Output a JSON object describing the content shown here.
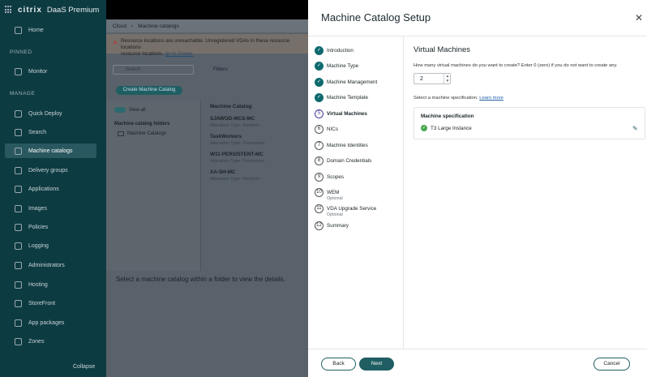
{
  "background": {
    "brand": {
      "logo": "citrix",
      "product": "DaaS Premium"
    },
    "nav": {
      "home": "Home",
      "pinned_section": "PINNED",
      "monitor": "Monitor",
      "manage_section": "MANAGE",
      "quick_deploy": "Quick Deploy",
      "search": "Search",
      "machine_catalogs": "Machine catalogs",
      "delivery_groups": "Delivery groups",
      "applications": "Applications",
      "images": "Images",
      "policies": "Policies",
      "logging": "Logging",
      "administrators": "Administrators",
      "hosting": "Hosting",
      "storefront": "StoreFront",
      "app_packages": "App packages",
      "zones": "Zones",
      "collapse": "Collapse"
    },
    "breadcrumb": {
      "root": "Cloud",
      "current": "Machine catalogs"
    },
    "warning": {
      "text": "Resource locations are unreachable. Unregistered VDAs in these resource locations",
      "link_prefix": "resource locations.",
      "link": "go to Zones."
    },
    "search_placeholder": "Search",
    "filters": "Filters",
    "create_button": "Create Machine Catalog",
    "view_all": "View all",
    "folders_title": "Machine catalog folders",
    "folder_name": "Machine Catalogs",
    "column_header": "Machine Catalog",
    "catalogs": [
      {
        "name": "SJAWOD-MCS-MC",
        "sub": "Allocation Type: Random"
      },
      {
        "name": "TaskWorkers",
        "sub": "Allocation Type: Permanent"
      },
      {
        "name": "W11-PERSISTENT-MC",
        "sub": "Allocation Type: Permanent"
      },
      {
        "name": "XA-SH-MC",
        "sub": "Allocation Type: Random"
      }
    ],
    "select_message": "Select a machine catalog within a folder to view the details."
  },
  "modal": {
    "title": "Machine Catalog Setup",
    "steps": [
      {
        "num": "1",
        "label": "Introduction",
        "state": "done"
      },
      {
        "num": "2",
        "label": "Machine Type",
        "state": "done"
      },
      {
        "num": "3",
        "label": "Machine Management",
        "state": "done"
      },
      {
        "num": "4",
        "label": "Machine Template",
        "state": "done"
      },
      {
        "num": "5",
        "label": "Virtual Machines",
        "state": "current"
      },
      {
        "num": "6",
        "label": "NICs",
        "state": "todo"
      },
      {
        "num": "7",
        "label": "Machine Identities",
        "state": "todo"
      },
      {
        "num": "8",
        "label": "Domain Credentials",
        "state": "todo"
      },
      {
        "num": "9",
        "label": "Scopes",
        "state": "todo"
      },
      {
        "num": "10",
        "label": "WEM",
        "sub": "Optional",
        "state": "todo"
      },
      {
        "num": "11",
        "label": "VDA Upgrade Service",
        "sub": "Optional",
        "state": "todo"
      },
      {
        "num": "12",
        "label": "Summary",
        "state": "todo"
      }
    ],
    "section_title": "Virtual Machines",
    "question": "How many virtual machines do you want to create? Enter 0 (zero) if you do not want to create any.",
    "vm_count": "2",
    "spec_prompt": "Select a machine specification.",
    "learn_more": "Learn more",
    "spec_header": "Machine specification",
    "spec_value": "T3 Large Instance",
    "buttons": {
      "back": "Back",
      "next": "Next",
      "cancel": "Cancel"
    }
  }
}
